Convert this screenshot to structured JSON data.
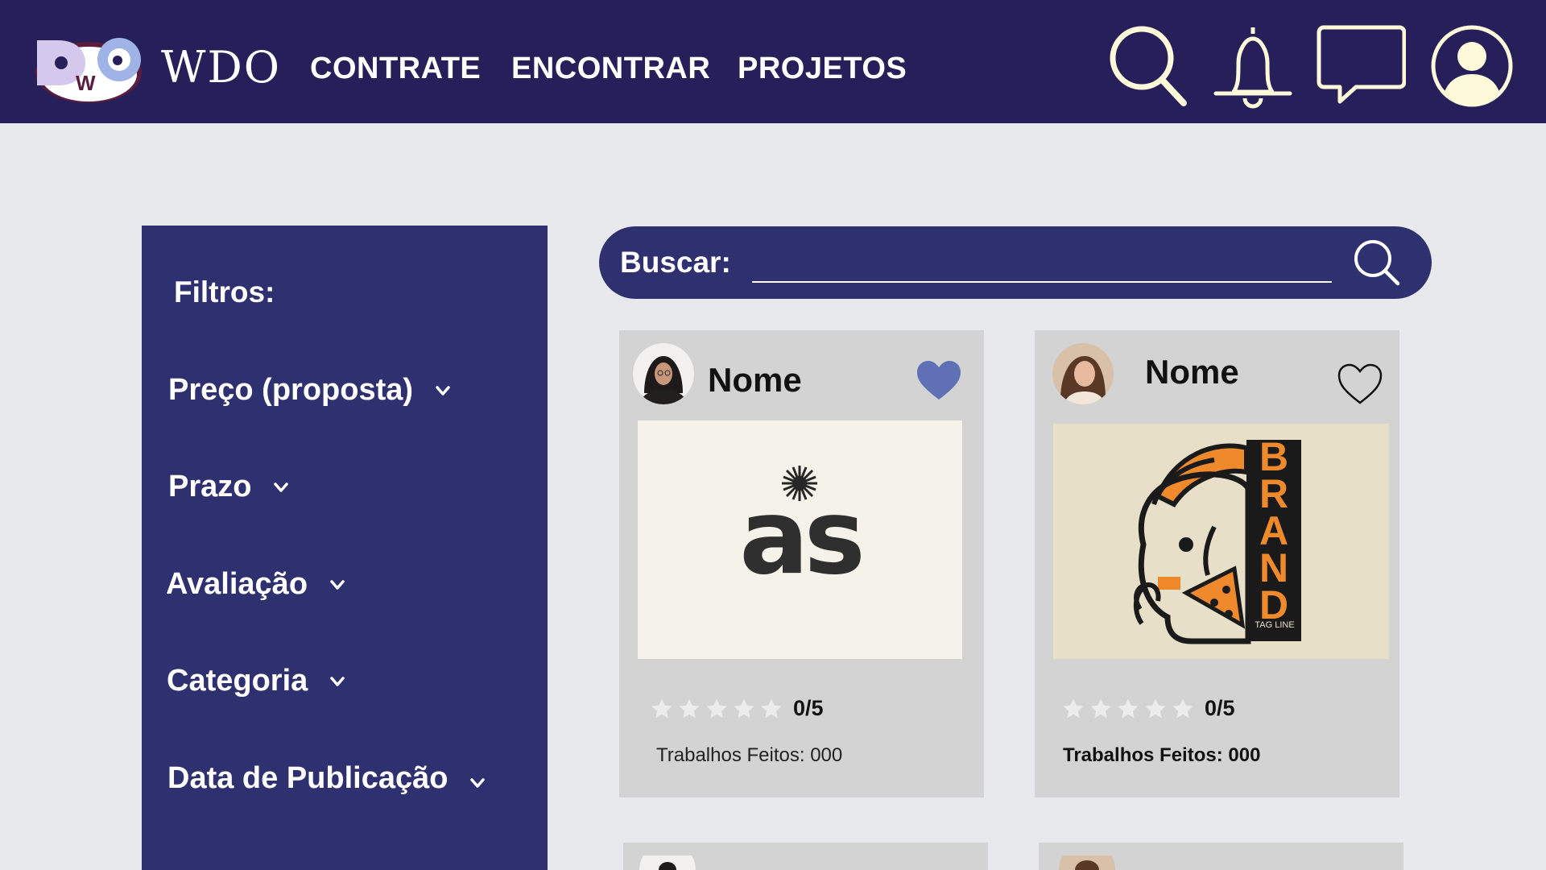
{
  "header": {
    "brand": "WDO",
    "logo_letters": [
      "D",
      "W",
      "O"
    ],
    "nav": [
      "CONTRATE",
      "ENCONTRAR",
      "PROJETOS"
    ],
    "icons": [
      "search-icon",
      "bell-icon",
      "chat-icon",
      "user-icon"
    ]
  },
  "colors": {
    "header_bg": "#271f59",
    "panel_bg": "#2e306f",
    "page_bg": "#e8e9ec",
    "card_bg": "#d3d3d3",
    "accent_icon": "#fdf9d9",
    "heart_filled": "#5f70b4",
    "star_empty": "#ececec"
  },
  "filters": {
    "title": "Filtros:",
    "items": [
      "Preço (proposta)",
      "Prazo",
      "Avaliação",
      "Categoria",
      "Data de Publicação"
    ]
  },
  "search": {
    "label": "Buscar:",
    "value": ""
  },
  "cards": [
    {
      "name": "Nome",
      "favorited": true,
      "thumbnail_text": "as",
      "rating_text": "0/5",
      "stars_filled": 0,
      "jobs": "Trabalhos Feitos: 000"
    },
    {
      "name": "Nome",
      "favorited": false,
      "thumbnail_text": "BRAND",
      "thumbnail_sub": "TAG LINE",
      "rating_text": "0/5",
      "stars_filled": 0,
      "jobs": "Trabalhos Feitos: 000"
    }
  ]
}
